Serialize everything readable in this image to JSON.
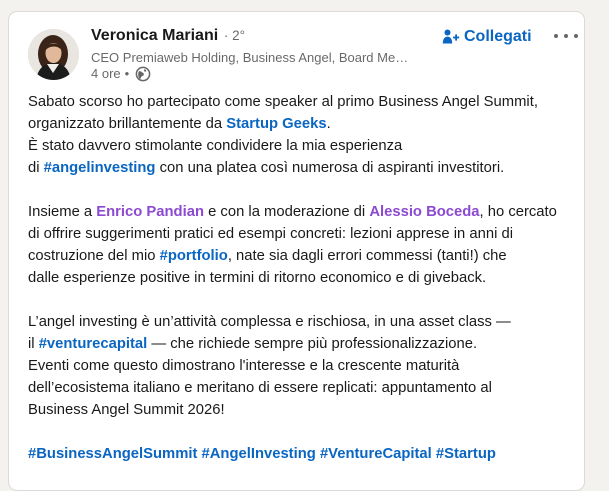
{
  "post": {
    "author": {
      "name": "Veronica Mariani",
      "degree": " · 2°",
      "headline": "CEO Premiaweb Holding, Business Angel, Board Me…",
      "time": "4 ore",
      "separator": "•"
    },
    "connect_label": "Collegati",
    "body": {
      "p1_l1": "Sabato scorso ho partecipato come speaker al primo Business Angel Summit,",
      "p1_l2_pre": "organizzato brillantemente da ",
      "p1_l2_link": "Startup Geeks",
      "p1_l2_post": ".",
      "p1_l3": "È stato davvero stimolante condividere la mia esperienza",
      "p1_l4_pre": "di ",
      "p1_l4_tag": "#angelinvesting",
      "p1_l4_post": " con una platea così numerosa di aspiranti investitori.",
      "p2_l1_pre": "Insieme a ",
      "p2_l1_mention1": "Enrico Pandian",
      "p2_l1_mid": " e con la moderazione di ",
      "p2_l1_mention2": "Alessio Boceda",
      "p2_l1_post": ", ho cercato",
      "p2_l2": "di offrire suggerimenti pratici ed esempi concreti: lezioni apprese in anni di",
      "p2_l3_pre": "costruzione del mio ",
      "p2_l3_tag": "#portfolio",
      "p2_l3_post": ", nate sia dagli errori commessi (tanti!) che",
      "p2_l4": "dalle esperienze positive in termini di ritorno economico e di giveback.",
      "p3_l1": "L’angel investing è un’attività complessa e rischiosa, in una asset class —",
      "p3_l2_pre": "il ",
      "p3_l2_tag": "#venturecapital",
      "p3_l2_post": " — che richiede sempre più professionalizzazione.",
      "p3_l3": "Eventi come questo dimostrano l'interesse e la crescente maturità",
      "p3_l4": "dell’ecosistema italiano e meritano di essere replicati: appuntamento al",
      "p3_l5": "Business Angel Summit 2026!"
    },
    "hashtags": [
      "#BusinessAngelSummit",
      "#AngelInvesting",
      "#VentureCapital",
      "#Startup"
    ]
  },
  "colors": {
    "link": "#0a66c2",
    "mention": "#8c4ad1",
    "text": "#191919",
    "secondary": "#666666"
  },
  "icons": {
    "connect": "person-add-icon",
    "visibility": "globe-icon",
    "menu": "more-horizontal-icon"
  }
}
